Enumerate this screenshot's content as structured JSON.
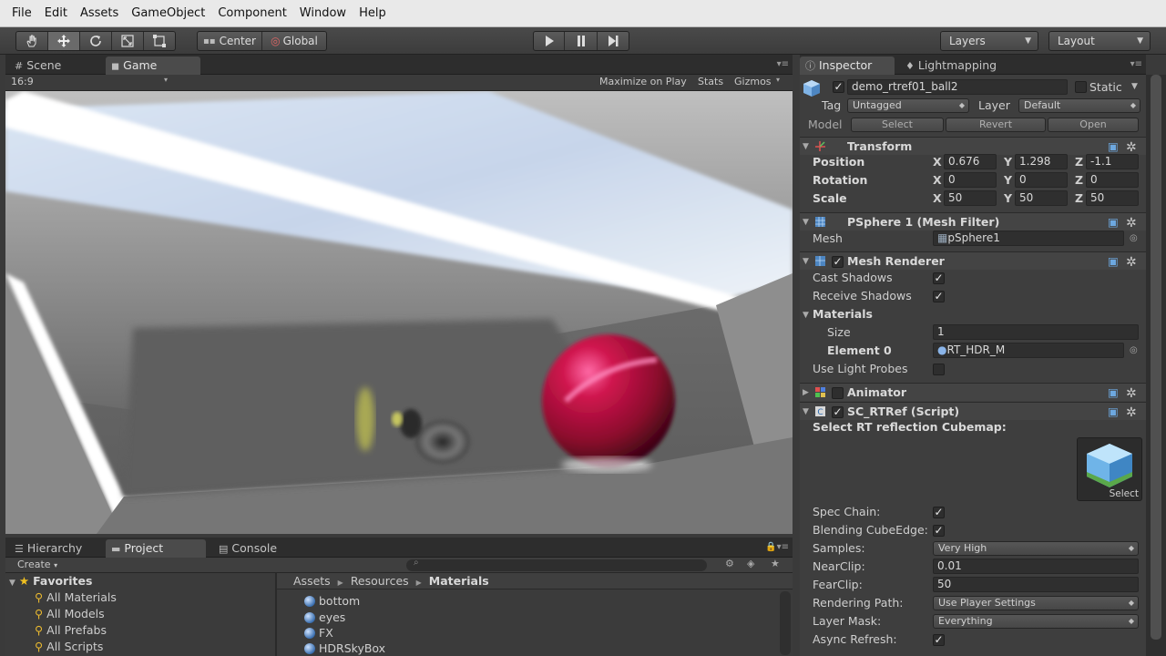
{
  "menu": [
    "File",
    "Edit",
    "Assets",
    "GameObject",
    "Component",
    "Window",
    "Help"
  ],
  "toolbar": {
    "pivot": "Center",
    "space": "Global",
    "layers": "Layers",
    "layout": "Layout"
  },
  "scene_tabs": {
    "scene": "Scene",
    "game": "Game"
  },
  "game_bar": {
    "aspect": "16:9",
    "maximize": "Maximize on Play",
    "stats": "Stats",
    "gizmos": "Gizmos"
  },
  "inspector": {
    "tab": "Inspector",
    "lightmap_tab": "Lightmapping",
    "object_name": "demo_rtref01_ball2",
    "static_label": "Static",
    "tag_label": "Tag",
    "tag_value": "Untagged",
    "layer_label": "Layer",
    "layer_value": "Default",
    "model_label": "Model",
    "model_select": "Select",
    "model_revert": "Revert",
    "model_open": "Open",
    "transform": {
      "title": "Transform",
      "position": {
        "label": "Position",
        "x": "0.676",
        "y": "1.298",
        "z": "-1.1"
      },
      "rotation": {
        "label": "Rotation",
        "x": "0",
        "y": "0",
        "z": "0"
      },
      "scale": {
        "label": "Scale",
        "x": "50",
        "y": "50",
        "z": "50"
      }
    },
    "mesh_filter": {
      "title": "PSphere 1 (Mesh Filter)",
      "mesh_label": "Mesh",
      "mesh_value": "pSphere1"
    },
    "mesh_renderer": {
      "title": "Mesh Renderer",
      "cast_shadows": "Cast Shadows",
      "receive_shadows": "Receive Shadows",
      "materials": "Materials",
      "size_label": "Size",
      "size_value": "1",
      "element0_label": "Element 0",
      "element0_value": "RT_HDR_M",
      "light_probes": "Use Light Probes"
    },
    "animator": {
      "title": "Animator"
    },
    "script": {
      "title": "SC_RTRef (Script)",
      "cubemap_label": "Select RT reflection Cubemap:",
      "cubemap_select": "Select",
      "spec_chain": "Spec Chain:",
      "blending": "Blending CubeEdge:",
      "samples_label": "Samples:",
      "samples_value": "Very High",
      "nearclip_label": "NearClip:",
      "nearclip_value": "0.01",
      "farclip_label": "FearClip:",
      "farclip_value": "50",
      "rendering_label": "Rendering Path:",
      "rendering_value": "Use Player Settings",
      "layermask_label": "Layer Mask:",
      "layermask_value": "Everything",
      "async_label": "Async Refresh:"
    }
  },
  "bottom_tabs": {
    "hierarchy": "Hierarchy",
    "project": "Project",
    "console": "Console"
  },
  "project": {
    "create": "Create",
    "favorites": "Favorites",
    "fav_items": [
      "All Materials",
      "All Models",
      "All Prefabs",
      "All Scripts"
    ],
    "breadcrumb": [
      "Assets",
      "Resources",
      "Materials"
    ],
    "assets": [
      "bottom",
      "eyes",
      "FX",
      "HDRSkyBox"
    ]
  },
  "colors": {
    "menubar_bg": "#e9e9e9",
    "panel_bg": "#3e3e3e",
    "ball_color": "#b0103a"
  }
}
